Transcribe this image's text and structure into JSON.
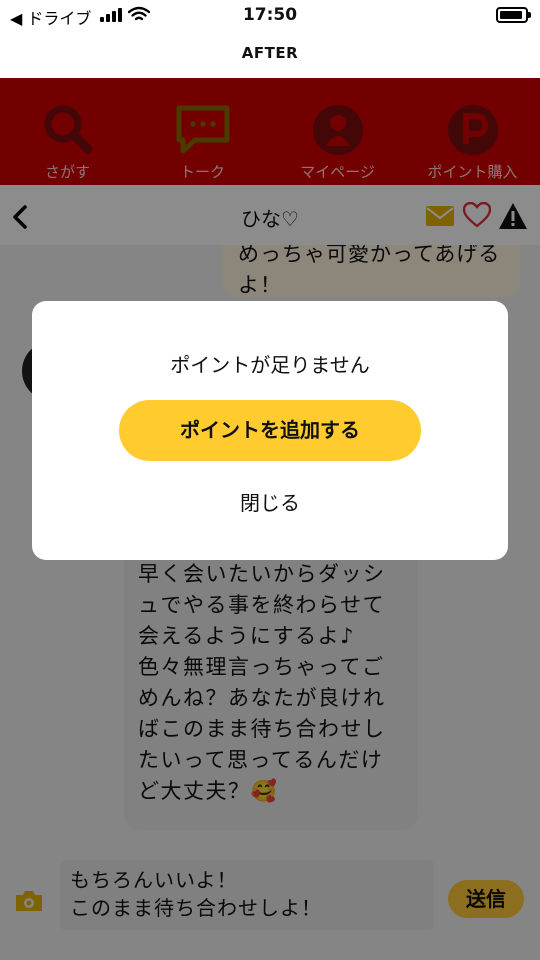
{
  "status_bar": {
    "back_app": "◀ ドライブ",
    "time": "17:50"
  },
  "app_title": "AFTER",
  "nav": [
    {
      "label": "さがす",
      "icon": "search-icon"
    },
    {
      "label": "トーク",
      "icon": "chat-icon"
    },
    {
      "label": "マイページ",
      "icon": "person-icon"
    },
    {
      "label": "ポイント購入",
      "icon": "points-icon"
    }
  ],
  "chat_header": {
    "name": "ひな♡"
  },
  "messages": {
    "sent_top": "めっちゃ可愛かってあげるよ！",
    "received": "早く会いたいからダッシュでやる事を終わらせて会えるようにするよ♪\n色々無理言っちゃってごめんね？あなたが良ければこのまま待ち合わせしたいって思ってるんだけど大丈夫？🥰"
  },
  "input": {
    "text": "もちろんいいよ！\nこのまま待ち合わせしよ！",
    "send_label": "送信"
  },
  "modal": {
    "message": "ポイントが足りません",
    "add_button": "ポイントを追加する",
    "close_button": "閉じる"
  },
  "colors": {
    "nav_red": "#d00000",
    "accent_yellow": "#ffcb2f",
    "heart": "#e03040"
  }
}
